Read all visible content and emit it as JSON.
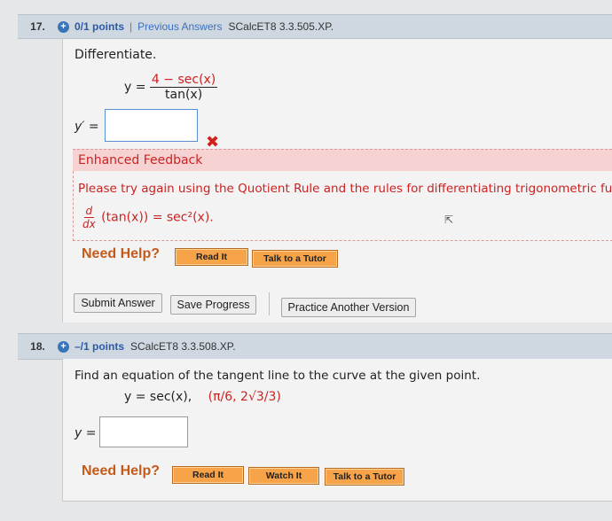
{
  "q17": {
    "number": "17.",
    "points": "0/1 points",
    "separator": "|",
    "previous_answers": "Previous Answers",
    "code": "SCalcET8 3.3.505.XP.",
    "prompt": "Differentiate.",
    "eq_lhs": "y =",
    "numerator": "4 − sec(x)",
    "denominator": "tan(x)",
    "answer_label": "y′ =",
    "answer_value": "",
    "incorrect_mark": "✖",
    "feedback_title": "Enhanced Feedback",
    "feedback_text": "Please try again using the Quotient Rule and the rules for differentiating trigonometric funct",
    "hint_d": "d",
    "hint_dx": "dx",
    "hint_expr": "(tan(x)) = sec²(x).",
    "need_help": "Need Help?",
    "read_it": "Read It",
    "talk_to_tutor": "Talk to a Tutor",
    "submit_answer": "Submit Answer",
    "save_progress": "Save Progress",
    "practice_another": "Practice Another Version"
  },
  "q18": {
    "number": "18.",
    "points": "–/1 points",
    "code": "SCalcET8 3.3.508.XP.",
    "prompt": "Find an equation of the tangent line to the curve at the given point.",
    "equation": "y = sec(x),",
    "point": "(π/6, 2√3/3)",
    "answer_label": "y =",
    "answer_value": "",
    "need_help": "Need Help?",
    "read_it": "Read It",
    "watch_it": "Watch It",
    "talk_to_tutor": "Talk to a Tutor"
  },
  "colors": {
    "header_bg": "#cfd8e0",
    "points_blue": "#2a5aa8",
    "feedback_red": "#cc2222",
    "feedback_bg": "#f7d2d2",
    "help_orange": "#c45a1a",
    "button_orange": "#f6a34a"
  },
  "icons": [
    "plus-circle-icon",
    "incorrect-x-icon",
    "mouse-cursor-icon"
  ]
}
